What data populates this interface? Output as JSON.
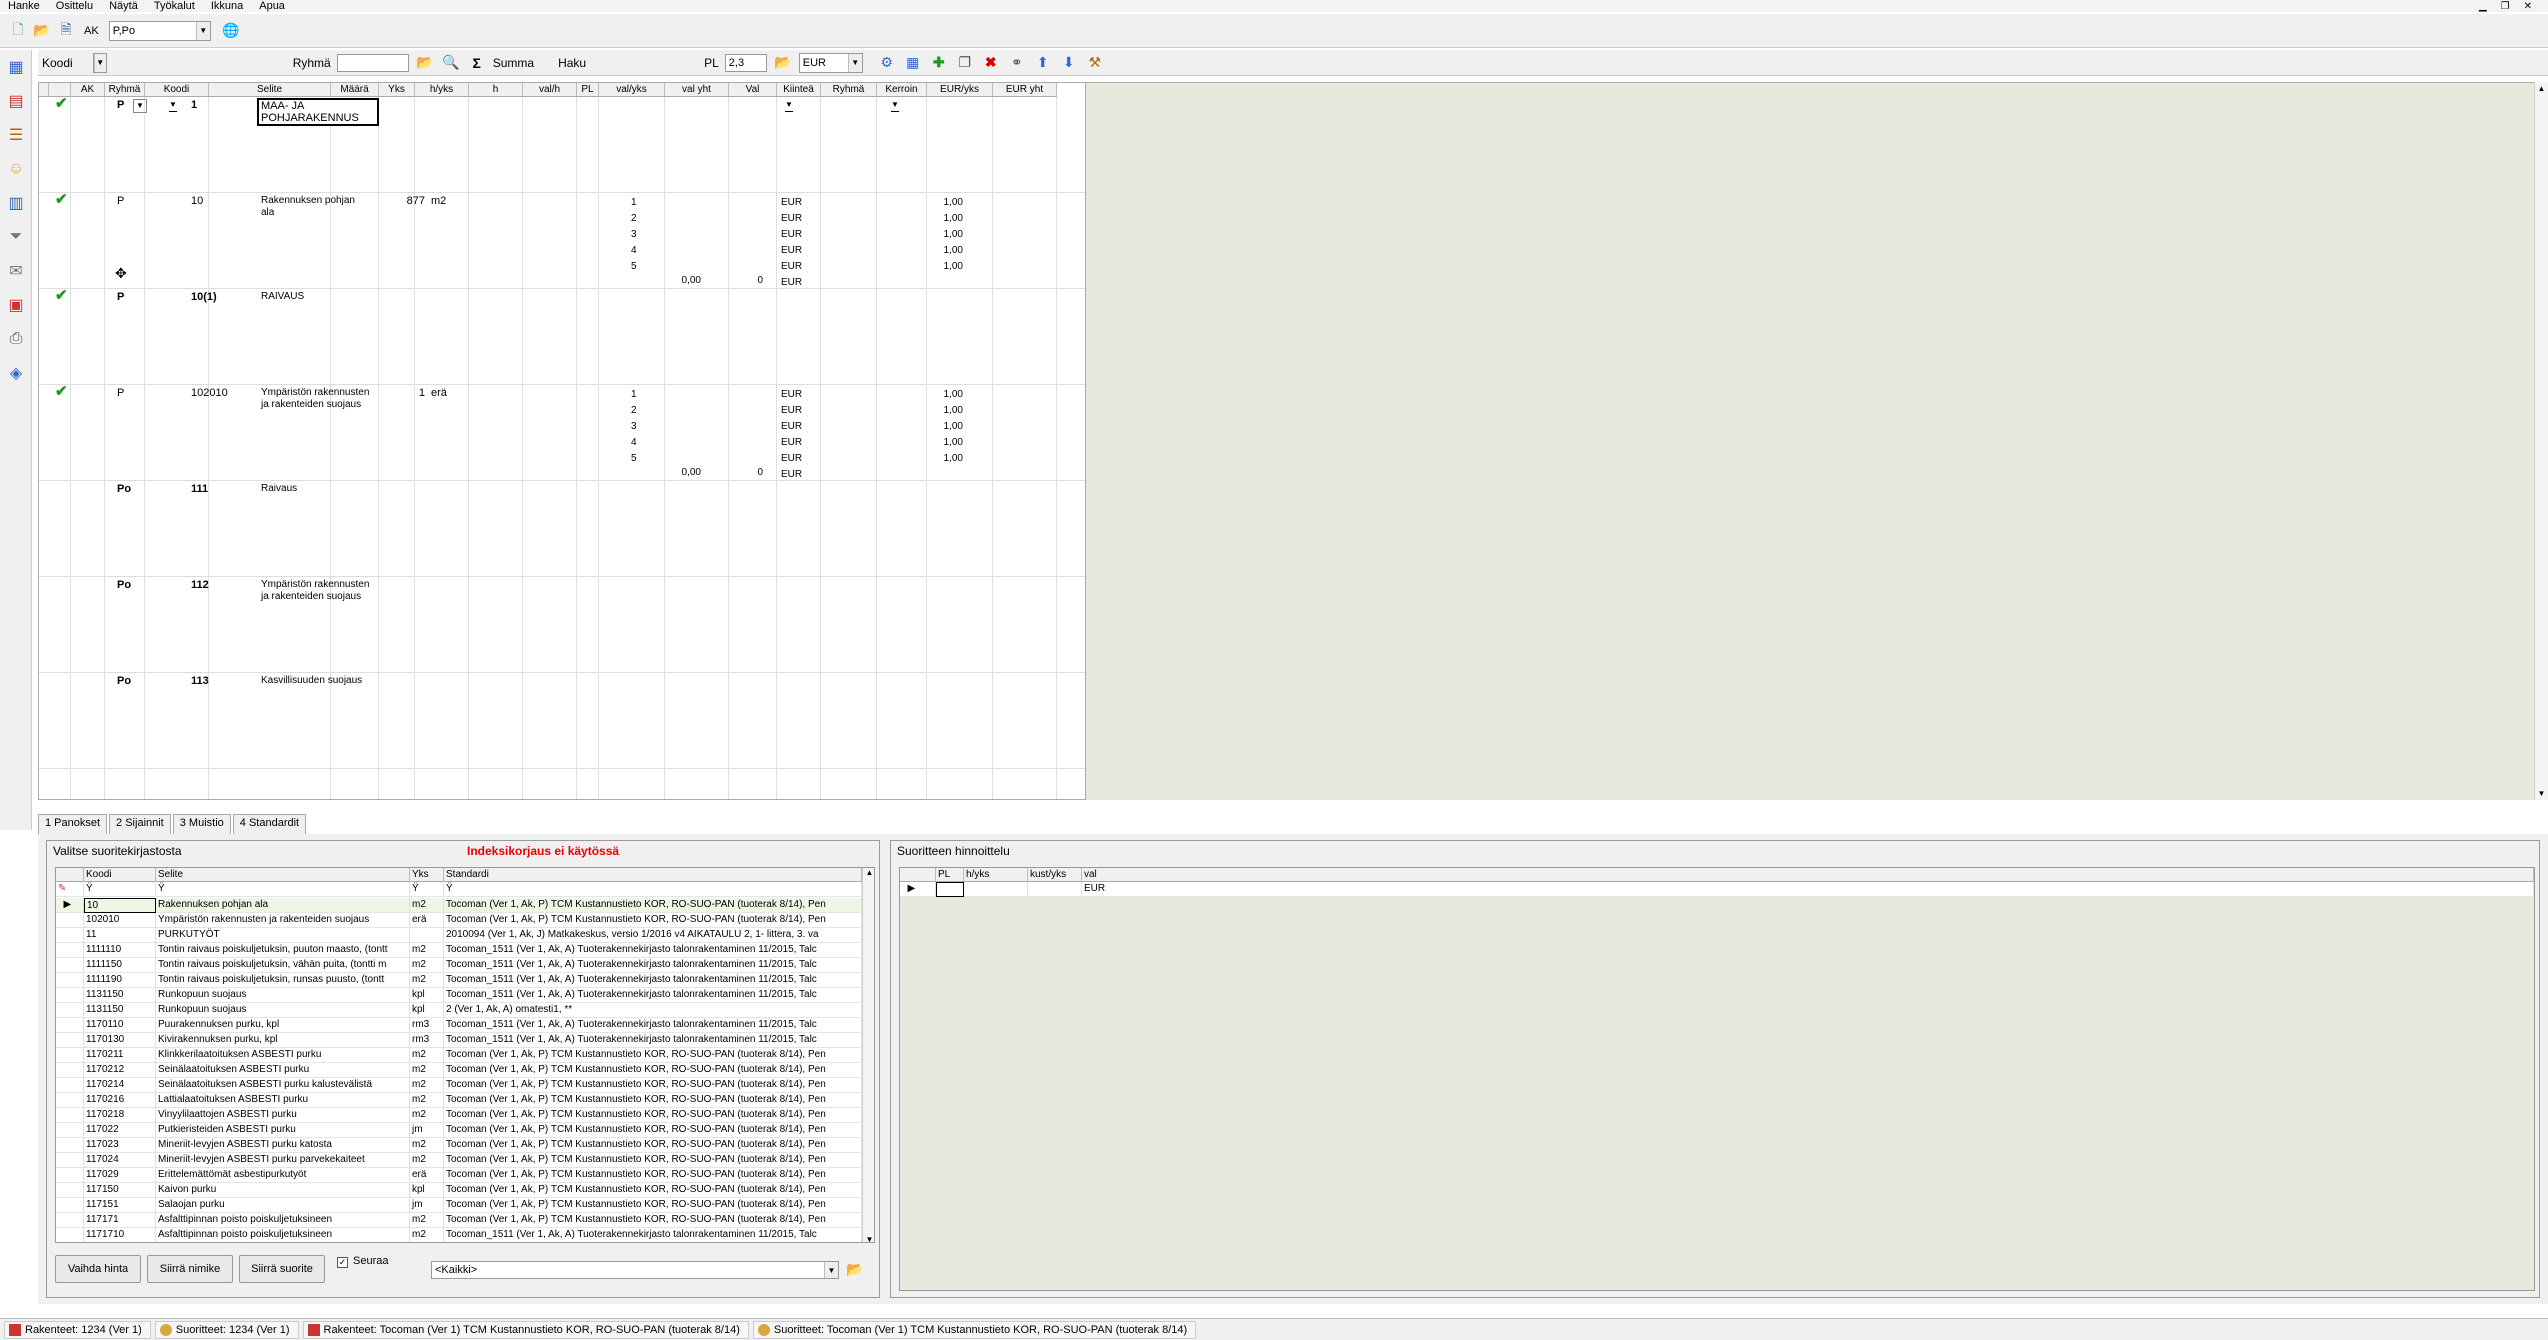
{
  "menu": [
    "Hanke",
    "Osittelu",
    "Näytä",
    "Työkalut",
    "Ikkuna",
    "Apua"
  ],
  "toolbar1": {
    "ak_label": "AK",
    "ak_value": "P,Po"
  },
  "toolbar2": {
    "koodi_label": "Koodi",
    "ryhma_label": "Ryhmä",
    "summa_label": "Summa",
    "haku_label": "Haku",
    "pl_label": "PL",
    "pl_value": "2,3",
    "currency": "EUR"
  },
  "grid": {
    "headers": [
      "AK",
      "Ryhmä",
      "Koodi",
      "Selite",
      "Määrä",
      "Yks",
      "h/yks",
      "h",
      "val/h",
      "PL",
      "val/yks",
      "val yht",
      "Val",
      "Kiinteä",
      "Ryhmä",
      "Kerroin",
      "EUR/yks",
      "EUR yht"
    ],
    "rows": [
      {
        "check": true,
        "ak": "P",
        "koodi": "1",
        "selite": "MAA- JA\nPOHJARAKENNUS",
        "maara": "",
        "yks": "",
        "pl": "",
        "val": "",
        "kerroin": "",
        "valyks": "",
        "valyht": "",
        "bold": true
      },
      {
        "check": true,
        "ak": "P",
        "koodi": "10",
        "selite": "Rakennuksen pohjan\nala",
        "maara": "877",
        "yks": "m2",
        "pl": "1\n2\n3\n4\n5",
        "val": "EUR\nEUR\nEUR\nEUR\nEUR\nEUR",
        "kerroin": "1,00\n1,00\n1,00\n1,00\n1,00",
        "valyks": "0,00",
        "valyht": "0",
        "bold": false
      },
      {
        "check": true,
        "ak": "P",
        "koodi": "10(1)",
        "selite": "RAIVAUS",
        "maara": "",
        "yks": "",
        "pl": "",
        "val": "",
        "kerroin": "",
        "valyks": "",
        "valyht": "",
        "bold": true
      },
      {
        "check": true,
        "ak": "P",
        "koodi": "102010",
        "selite": "Ympäristön rakennusten\nja rakenteiden suojaus",
        "maara": "1",
        "yks": "erä",
        "pl": "1\n2\n3\n4\n5",
        "val": "EUR\nEUR\nEUR\nEUR\nEUR\nEUR",
        "kerroin": "1,00\n1,00\n1,00\n1,00\n1,00",
        "valyks": "0,00",
        "valyht": "0",
        "bold": false
      },
      {
        "check": false,
        "ak": "Po",
        "koodi": "111",
        "selite": "Raivaus",
        "maara": "",
        "yks": "",
        "pl": "",
        "val": "",
        "kerroin": "",
        "valyks": "",
        "valyht": "",
        "bold": true
      },
      {
        "check": false,
        "ak": "Po",
        "koodi": "112",
        "selite": "Ympäristön rakennusten\nja rakenteiden suojaus",
        "maara": "",
        "yks": "",
        "pl": "",
        "val": "",
        "kerroin": "",
        "valyks": "",
        "valyht": "",
        "bold": true
      },
      {
        "check": false,
        "ak": "Po",
        "koodi": "113",
        "selite": "Kasvillisuuden suojaus",
        "maara": "",
        "yks": "",
        "pl": "",
        "val": "",
        "kerroin": "",
        "valyks": "",
        "valyht": "",
        "bold": true
      }
    ]
  },
  "tabs": [
    "1 Panokset",
    "2 Sijainnit",
    "3 Muistio",
    "4 Standardit"
  ],
  "left_panel": {
    "title": "Valitse suoritekirjastosta",
    "warning": "Indeksikorjaus ei käytössä",
    "headers": [
      "Koodi",
      "Selite",
      "Yks",
      "Standardi"
    ],
    "rows": [
      [
        "10",
        "Rakennuksen pohjan ala",
        "m2",
        "Tocoman (Ver 1, Ak, P) TCM Kustannustieto KOR, RO-SUO-PAN (tuoterak 8/14), Pen"
      ],
      [
        "102010",
        "Ympäristön rakennusten ja rakenteiden suojaus",
        "erä",
        "Tocoman (Ver 1, Ak, P) TCM Kustannustieto KOR, RO-SUO-PAN (tuoterak 8/14), Pen"
      ],
      [
        "11",
        "PURKUTYÖT",
        "",
        "2010094 (Ver 1, Ak, J) Matkakeskus, versio 1/2016 v4 AIKATAULU 2, 1- littera, 3. va"
      ],
      [
        "1111110",
        "Tontin raivaus poiskuljetuksin, puuton maasto, (tontt",
        "m2",
        "Tocoman_1511 (Ver 1, Ak, A) Tuoterakennekirjasto talonrakentaminen 11/2015, Talc"
      ],
      [
        "1111150",
        "Tontin raivaus poiskuljetuksin, vähän puita, (tontti m",
        "m2",
        "Tocoman_1511 (Ver 1, Ak, A) Tuoterakennekirjasto talonrakentaminen 11/2015, Talc"
      ],
      [
        "1111190",
        "Tontin raivaus poiskuljetuksin, runsas puusto, (tontt",
        "m2",
        "Tocoman_1511 (Ver 1, Ak, A) Tuoterakennekirjasto talonrakentaminen 11/2015, Talc"
      ],
      [
        "1131150",
        "Runkopuun suojaus",
        "kpl",
        "Tocoman_1511 (Ver 1, Ak, A) Tuoterakennekirjasto talonrakentaminen 11/2015, Talc"
      ],
      [
        "1131150",
        "Runkopuun suojaus",
        "kpl",
        "2 (Ver 1, Ak, A) omatesti1, **"
      ],
      [
        "1170110",
        "Puurakennuksen purku,  kpl",
        "rm3",
        "Tocoman_1511 (Ver 1, Ak, A) Tuoterakennekirjasto talonrakentaminen 11/2015, Talc"
      ],
      [
        "1170130",
        "Kivirakennuksen purku,  kpl",
        "rm3",
        "Tocoman_1511 (Ver 1, Ak, A) Tuoterakennekirjasto talonrakentaminen 11/2015, Talc"
      ],
      [
        "1170211",
        "Klinkkerilaatoituksen ASBESTI purku",
        "m2",
        "Tocoman (Ver 1, Ak, P) TCM Kustannustieto KOR, RO-SUO-PAN (tuoterak 8/14), Pen"
      ],
      [
        "1170212",
        "Seinälaatoituksen ASBESTI purku",
        "m2",
        "Tocoman (Ver 1, Ak, P) TCM Kustannustieto KOR, RO-SUO-PAN (tuoterak 8/14), Pen"
      ],
      [
        "1170214",
        "Seinälaatoituksen ASBESTI purku kalustevälistä",
        "m2",
        "Tocoman (Ver 1, Ak, P) TCM Kustannustieto KOR, RO-SUO-PAN (tuoterak 8/14), Pen"
      ],
      [
        "1170216",
        "Lattialaatoituksen ASBESTI purku",
        "m2",
        "Tocoman (Ver 1, Ak, P) TCM Kustannustieto KOR, RO-SUO-PAN (tuoterak 8/14), Pen"
      ],
      [
        "1170218",
        "Vinyylilaattojen ASBESTI purku",
        "m2",
        "Tocoman (Ver 1, Ak, P) TCM Kustannustieto KOR, RO-SUO-PAN (tuoterak 8/14), Pen"
      ],
      [
        "117022",
        "Putkieristeiden ASBESTI purku",
        "jm",
        "Tocoman (Ver 1, Ak, P) TCM Kustannustieto KOR, RO-SUO-PAN (tuoterak 8/14), Pen"
      ],
      [
        "117023",
        "Mineriit-levyjen ASBESTI purku katosta",
        "m2",
        "Tocoman (Ver 1, Ak, P) TCM Kustannustieto KOR, RO-SUO-PAN (tuoterak 8/14), Pen"
      ],
      [
        "117024",
        "Mineriit-levyjen ASBESTI purku parvekekaiteet",
        "m2",
        "Tocoman (Ver 1, Ak, P) TCM Kustannustieto KOR, RO-SUO-PAN (tuoterak 8/14), Pen"
      ],
      [
        "117029",
        "Erittelemättömät asbestipurkutyöt",
        "erä",
        "Tocoman (Ver 1, Ak, P) TCM Kustannustieto KOR, RO-SUO-PAN (tuoterak 8/14), Pen"
      ],
      [
        "117150",
        "Kaivon purku",
        "kpl",
        "Tocoman (Ver 1, Ak, P) TCM Kustannustieto KOR, RO-SUO-PAN (tuoterak 8/14), Pen"
      ],
      [
        "117151",
        "Salaojan purku",
        "jm",
        "Tocoman (Ver 1, Ak, P) TCM Kustannustieto KOR, RO-SUO-PAN (tuoterak 8/14), Pen"
      ],
      [
        "117171",
        "Asfalttipinnan poisto poiskuljetuksineen",
        "m2",
        "Tocoman (Ver 1, Ak, P) TCM Kustannustieto KOR, RO-SUO-PAN (tuoterak 8/14), Pen"
      ],
      [
        "1171710",
        "Asfalttipinnan poisto poiskuljetuksineen",
        "m2",
        "Tocoman_1511 (Ver 1, Ak, A) Tuoterakennekirjasto talonrakentaminen 11/2015, Talc"
      ]
    ],
    "buttons": {
      "vaihda": "Vaihda hinta",
      "siirra_nimike": "Siirrä nimike",
      "siirra_suorite": "Siirrä suorite"
    },
    "seuraa_label": "Seuraa",
    "kaikki": "<Kaikki>"
  },
  "right_panel": {
    "title": "Suoritteen hinnoittelu",
    "headers": [
      "PL",
      "h/yks",
      "kust/yks",
      "val"
    ],
    "row_val": "EUR"
  },
  "statusbar": [
    {
      "icon": "book",
      "text": "Rakenteet: 1234 (Ver 1)"
    },
    {
      "icon": "user",
      "text": "Suoritteet: 1234 (Ver 1)"
    },
    {
      "icon": "book",
      "text": "Rakenteet: Tocoman (Ver 1) TCM Kustannustieto KOR, RO-SUO-PAN (tuoterak 8/14)"
    },
    {
      "icon": "user",
      "text": "Suoritteet: Tocoman (Ver 1) TCM Kustannustieto KOR, RO-SUO-PAN (tuoterak 8/14)"
    }
  ]
}
